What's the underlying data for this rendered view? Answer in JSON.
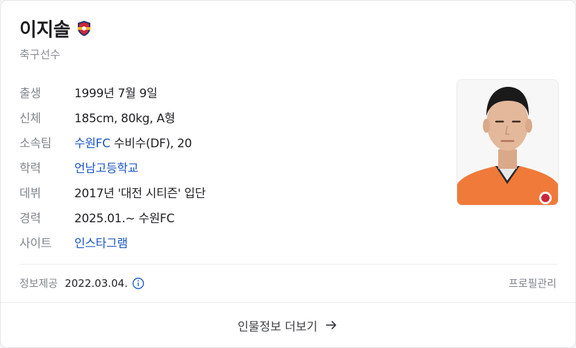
{
  "profile": {
    "name": "이지솔",
    "occupation": "축구선수",
    "club_badge_icon": "suwon-fc-badge-icon"
  },
  "info": [
    {
      "label": "출생",
      "value": "1999년 7월 9일"
    },
    {
      "label": "신체",
      "value": "185cm, 80kg, A형"
    },
    {
      "label": "소속팀",
      "link": "수원FC",
      "value": " 수비수(DF), 20"
    },
    {
      "label": "학력",
      "link": "언남고등학교"
    },
    {
      "label": "데뷔",
      "value": "2017년 '대전 시티즌' 입단"
    },
    {
      "label": "경력",
      "value": "2025.01.~ 수원FC"
    },
    {
      "label": "사이트",
      "link": "인스타그램"
    }
  ],
  "footer": {
    "source_label": "정보제공",
    "date": "2022.03.04.",
    "info_icon": "info-circle-icon",
    "manage_label": "프로필관리"
  },
  "more": {
    "label": "인물정보 더보기",
    "icon": "arrow-right-icon"
  },
  "colors": {
    "link": "#1a56c4",
    "jersey": "#f07a3a"
  }
}
